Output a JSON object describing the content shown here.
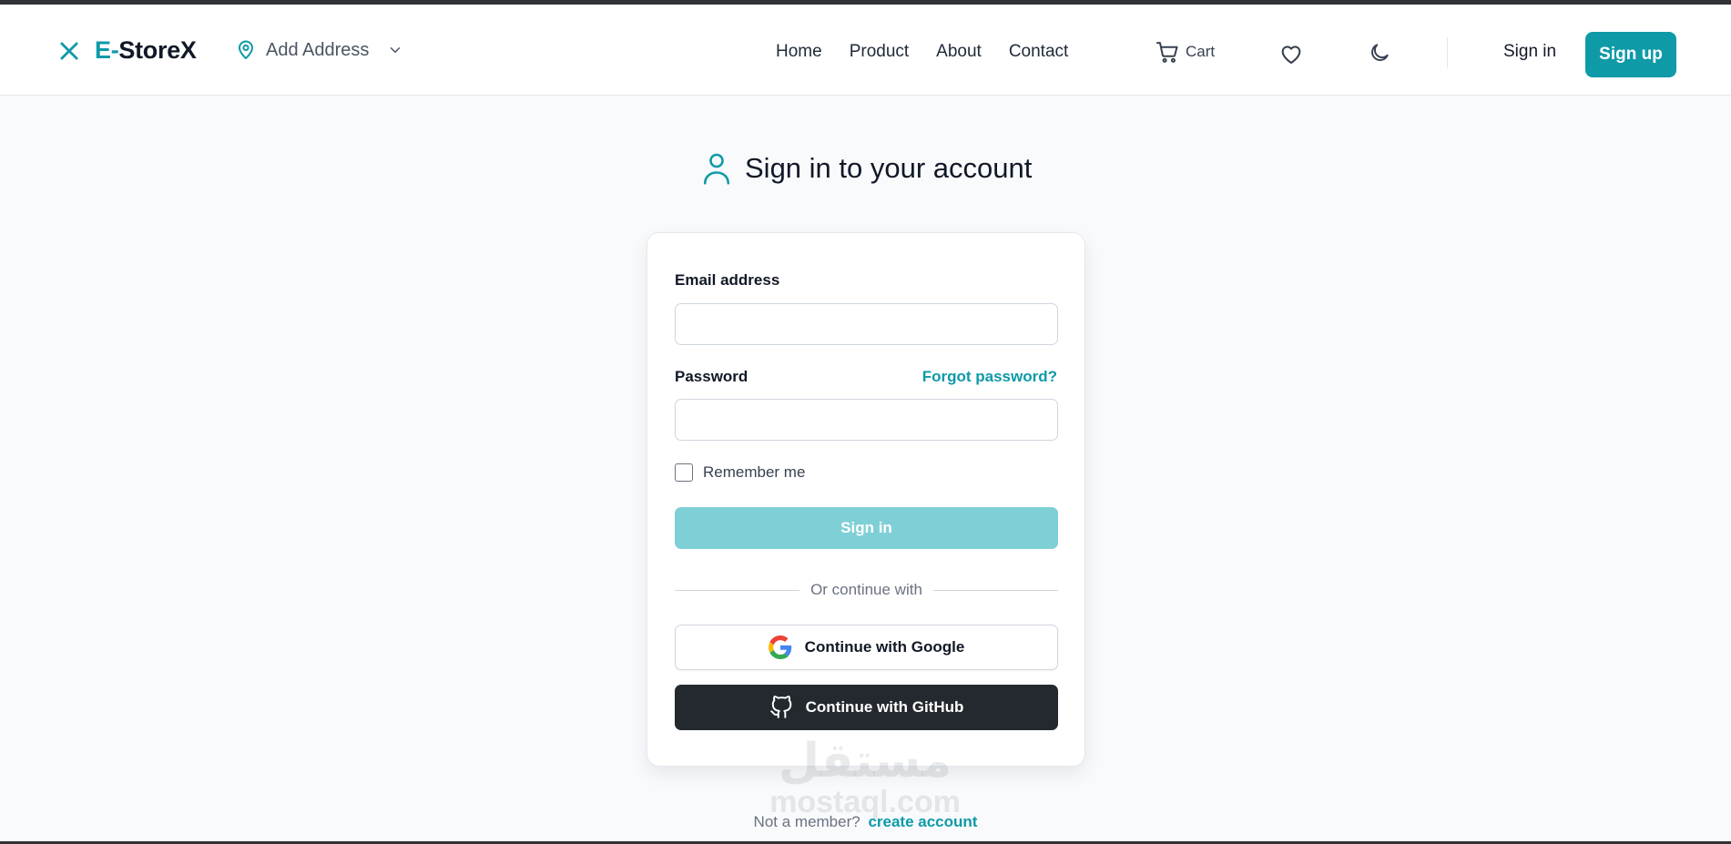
{
  "brand": {
    "name_prefix": "E-",
    "name_rest": "StoreX",
    "menu_icon": "close-icon",
    "accent_color": "#0e9aa7"
  },
  "address": {
    "label": "Add Address",
    "icon": "map-pin-icon",
    "dropdown_icon": "chevron-down-icon"
  },
  "nav": {
    "links": [
      "Home",
      "Product",
      "About",
      "Contact"
    ],
    "cart_label": "Cart",
    "wishlist_icon": "heart-icon",
    "theme_icon": "moon-icon",
    "signin_label": "Sign in",
    "signup_label": "Sign up"
  },
  "page": {
    "title": "Sign in to your account",
    "title_icon": "user-icon"
  },
  "form": {
    "email_label": "Email address",
    "email_value": "",
    "password_label": "Password",
    "password_value": "",
    "forgot_label": "Forgot password?",
    "remember_label": "Remember me",
    "remember_checked": false,
    "submit_label": "Sign in",
    "submit_color": "#7fd0d6",
    "divider_text": "Or continue with",
    "google_label": "Continue with Google",
    "github_label": "Continue with GitHub",
    "github_color": "#24292f"
  },
  "watermark": {
    "arabic": "مستقل",
    "latin": "mostaql.com"
  },
  "footer": {
    "prompt": "Not a member?",
    "link": "create account"
  }
}
